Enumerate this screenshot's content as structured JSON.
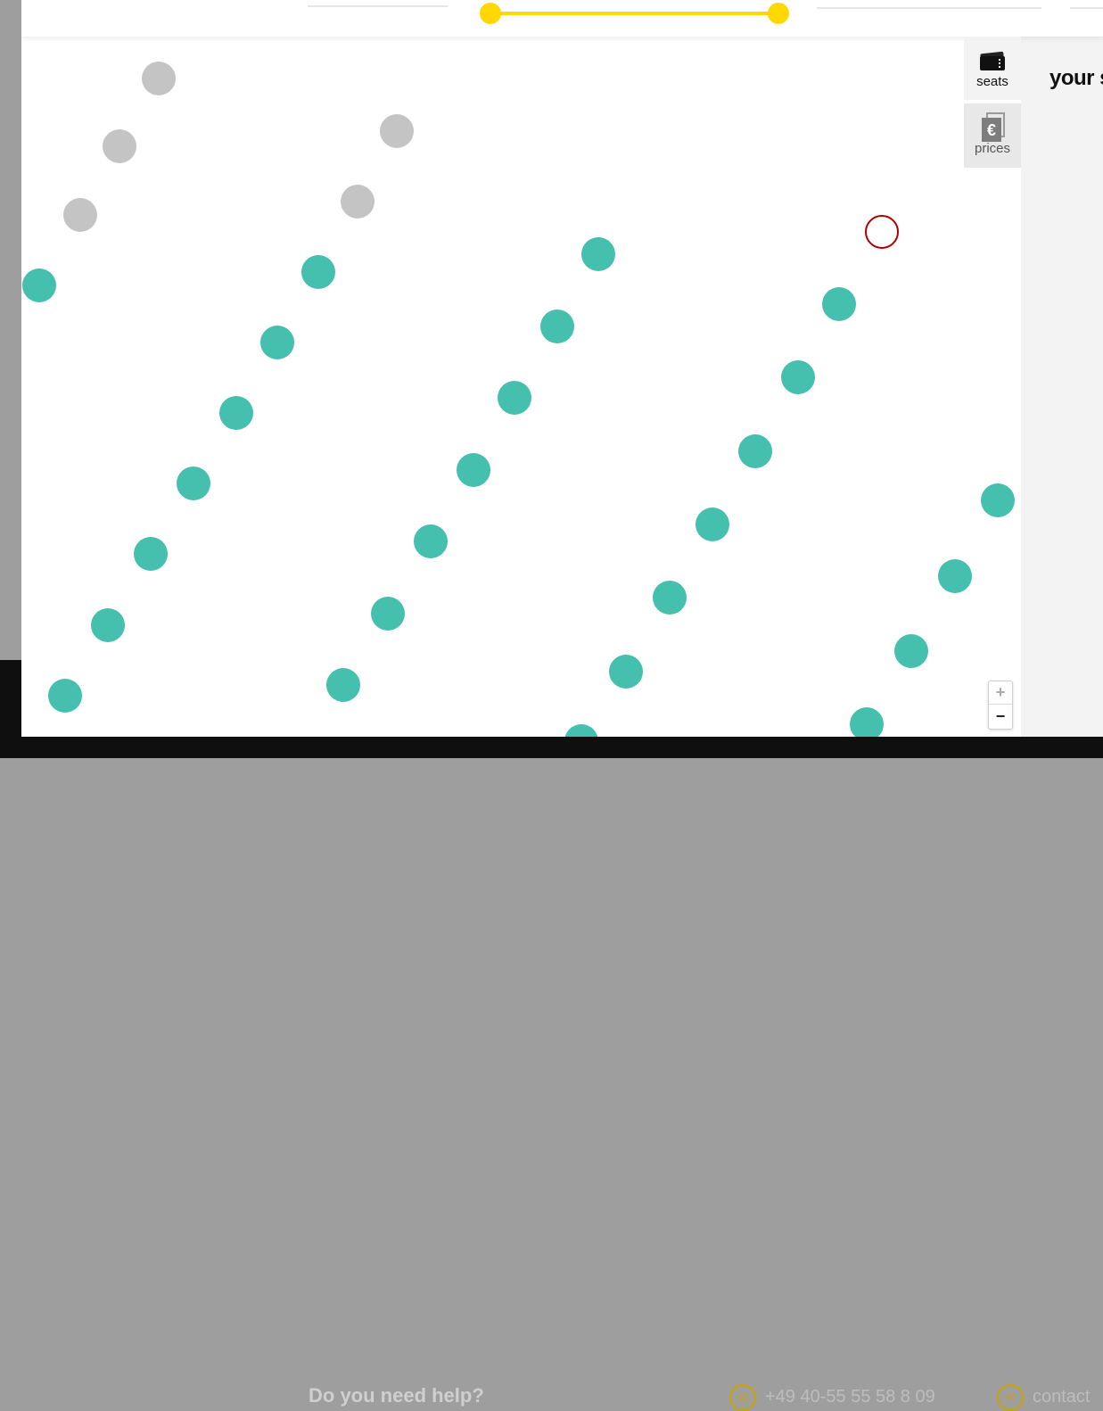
{
  "footer": {
    "help_text": "Do you need help?",
    "phone": "+49 40-55 55 58 8 09",
    "contact": "contact"
  },
  "slider": {
    "accent_color": "#ffd800"
  },
  "side_tabs": [
    {
      "label": "seats",
      "icon": "ticket-icon",
      "active": true
    },
    {
      "label": "prices",
      "icon": "euro-price-icon",
      "active": false
    }
  ],
  "zoom": {
    "in_label": "+",
    "out_label": "−"
  },
  "panel": {
    "title": "your s"
  },
  "colors": {
    "free_seat": "#45bfae",
    "taken_seat": "#c4c4c4",
    "selected_seat_border": "#b00000",
    "footer_bg": "#0f0f0f"
  }
}
